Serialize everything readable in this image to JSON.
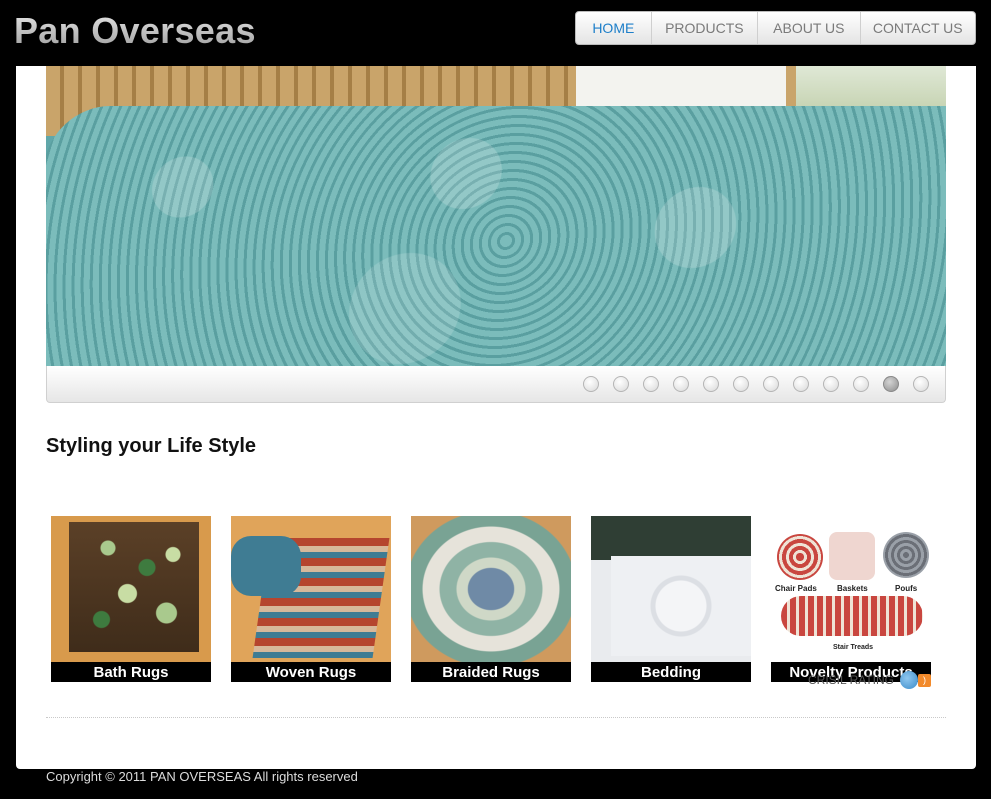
{
  "brand": {
    "logo_text": "Pan Overseas"
  },
  "nav": {
    "items": [
      {
        "label": "HOME",
        "active": true
      },
      {
        "label": "PRODUCTS",
        "active": false
      },
      {
        "label": "ABOUT US",
        "active": false
      },
      {
        "label": "CONTACT US",
        "active": false
      }
    ]
  },
  "slider": {
    "total_slides": 12,
    "active_slide": 11
  },
  "main": {
    "tagline": "Styling your Life Style"
  },
  "products": [
    {
      "label": "Bath Rugs"
    },
    {
      "label": "Woven Rugs"
    },
    {
      "label": "Braided Rugs"
    },
    {
      "label": "Bedding"
    },
    {
      "label": "Novelty Products",
      "sublabels": [
        "Chair Pads",
        "Baskets",
        "Poufs",
        "Stair Treads"
      ]
    }
  ],
  "footer": {
    "crisil_label": "CRISIL RATING",
    "rss_icon": "rss-icon",
    "copyright": "Copyright © 2011 PAN OVERSEAS All rights reserved"
  },
  "colors": {
    "accent": "#1e7fc9",
    "background": "#000000"
  }
}
